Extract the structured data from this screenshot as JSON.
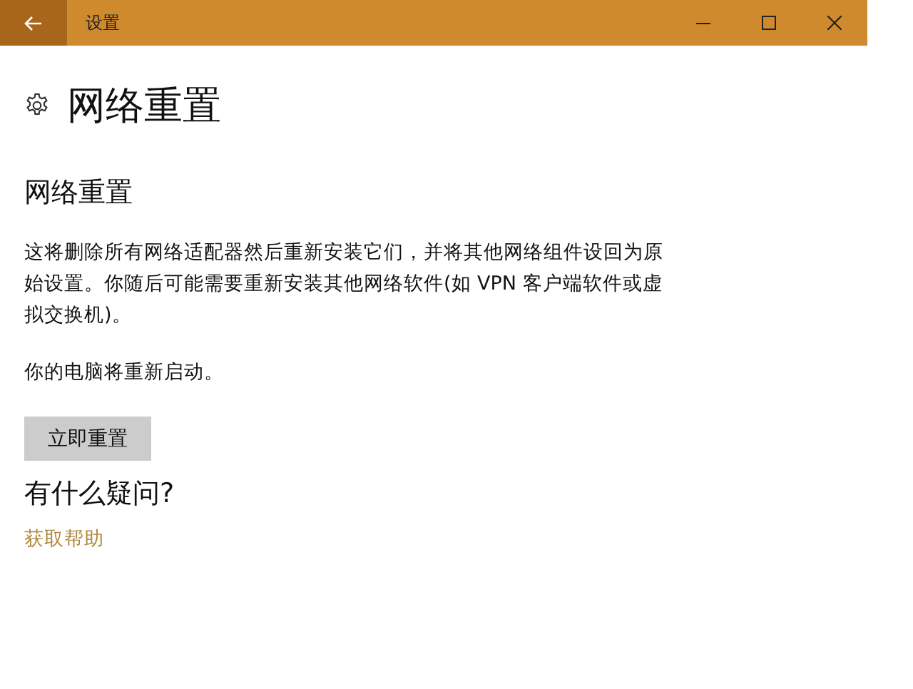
{
  "window": {
    "title": "设置"
  },
  "page_title": "网络重置",
  "section_title": "网络重置",
  "description": "这将删除所有网络适配器然后重新安装它们，并将其他网络组件设回为原始设置。你随后可能需要重新安装其他网络软件(如 VPN 客户端软件或虚拟交换机)。",
  "restart_note": "你的电脑将重新启动。",
  "reset_button": "立即重置",
  "help_title": "有什么疑问?",
  "help_link": "获取帮助"
}
